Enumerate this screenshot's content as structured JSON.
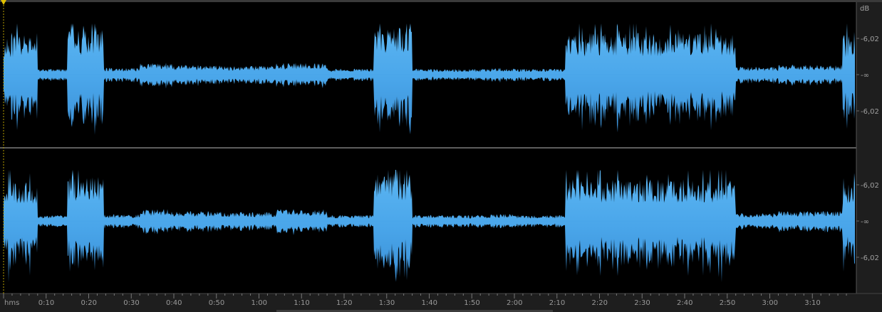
{
  "app": {
    "view": "waveform-editor"
  },
  "colors": {
    "background": "#000000",
    "waveform": "#4aa6ea",
    "waveform_dark": "#2f7fc6",
    "channel_divider": "#bdbdbd",
    "ruler_text": "#9a9a9a",
    "marker": "#e0c000"
  },
  "db_scale": {
    "unit": "dB",
    "channel_top": [
      "-6,02",
      "-∞",
      "-6,02"
    ],
    "channel_bottom": [
      "-6,02",
      "-∞",
      "-6,02"
    ]
  },
  "time_ruler": {
    "format_label": "hms",
    "ticks": [
      "0:10",
      "0:20",
      "0:30",
      "0:40",
      "0:50",
      "1:00",
      "1:10",
      "1:20",
      "1:30",
      "1:40",
      "1:50",
      "2:00",
      "2:10",
      "2:20",
      "2:30",
      "2:40",
      "2:50",
      "3:00",
      "3:10"
    ]
  },
  "cursor": {
    "position_seconds": 0
  },
  "duration_seconds": 199,
  "channels": [
    {
      "name": "",
      "envelope_levels": [
        0.45,
        0.2,
        0.55,
        0.12,
        0.15,
        0.18,
        0.12,
        0.15,
        0.5,
        0.12,
        0.15,
        0.1,
        0.55,
        0.45,
        0.48,
        0.1,
        0.15,
        0.45,
        0.5,
        0.12,
        0.48,
        0.1
      ]
    },
    {
      "name": "",
      "envelope_levels": [
        0.45,
        0.2,
        0.55,
        0.12,
        0.15,
        0.18,
        0.12,
        0.15,
        0.5,
        0.12,
        0.15,
        0.1,
        0.55,
        0.45,
        0.48,
        0.1,
        0.15,
        0.45,
        0.5,
        0.12,
        0.48,
        0.1
      ]
    }
  ]
}
